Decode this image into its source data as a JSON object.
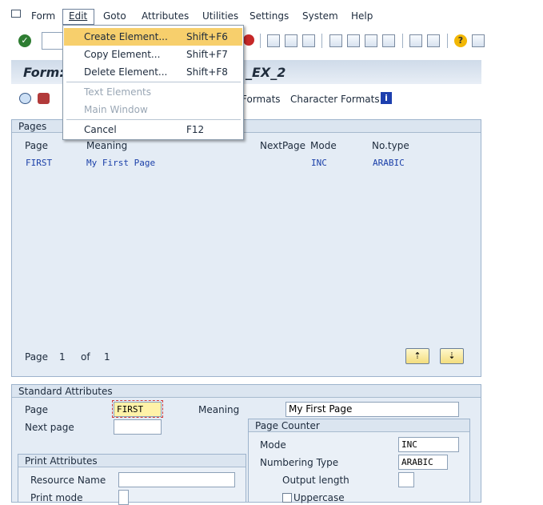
{
  "menubar": {
    "items": [
      "Form",
      "Edit",
      "Goto",
      "Attributes",
      "Utilities",
      "Settings",
      "System",
      "Help"
    ]
  },
  "dropdown": {
    "items": [
      {
        "label": "Create Element...",
        "shortcut": "Shift+F6",
        "state": "highlighted"
      },
      {
        "label": "Copy Element...",
        "shortcut": "Shift+F7",
        "state": "normal"
      },
      {
        "label": "Delete Element...",
        "shortcut": "Shift+F8",
        "state": "normal"
      },
      {
        "label": "Text Elements",
        "shortcut": "",
        "state": "disabled"
      },
      {
        "label": "Main Window",
        "shortcut": "",
        "state": "disabled"
      },
      {
        "label": "Cancel",
        "shortcut": "F12",
        "state": "normal"
      }
    ]
  },
  "title": {
    "prefix": "Form:",
    "suffix": "_EX_2"
  },
  "app_toolbar": {
    "formats_label": "Formats",
    "char_formats_label": "Character Formats"
  },
  "pages_panel": {
    "title": "Pages",
    "columns": [
      "Page",
      "Meaning",
      "NextPage",
      "Mode",
      "No.type"
    ],
    "rows": [
      {
        "page": "FIRST",
        "meaning": "My First Page",
        "nextpage": "",
        "mode": "INC",
        "notype": "ARABIC"
      }
    ],
    "pager": {
      "label": "Page",
      "current": "1",
      "of_label": "of",
      "total": "1"
    }
  },
  "std_attrs": {
    "title": "Standard Attributes",
    "page_label": "Page",
    "page_value": "FIRST",
    "meaning_label": "Meaning",
    "meaning_value": "My First Page",
    "next_page_label": "Next page",
    "next_page_value": ""
  },
  "page_counter": {
    "title": "Page Counter",
    "mode_label": "Mode",
    "mode_value": "INC",
    "numbering_label": "Numbering Type",
    "numbering_value": "ARABIC",
    "output_length_label": "Output length",
    "uppercase_label": "Uppercase"
  },
  "print_attrs": {
    "title": "Print Attributes",
    "resource_label": "Resource Name",
    "print_mode_label": "Print mode"
  },
  "colors": {
    "menu_highlight": "#f7cf6c",
    "table_text": "#1a3fa8",
    "panel_bg": "#e4ecf5"
  }
}
